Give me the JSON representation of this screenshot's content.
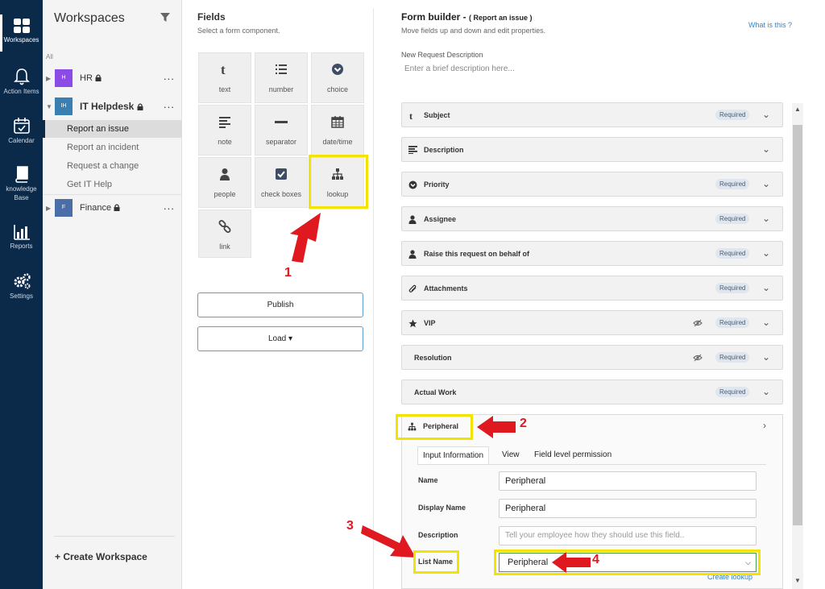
{
  "nav": {
    "items": [
      {
        "label": "Workspaces",
        "icon": "grid-icon"
      },
      {
        "label": "Action Items",
        "icon": "bell-icon"
      },
      {
        "label": "Calendar",
        "icon": "calendar-icon"
      },
      {
        "label_line1": "knowledge",
        "label_line2": "Base",
        "icon": "book-icon"
      },
      {
        "label": "Reports",
        "icon": "bar-chart-icon"
      },
      {
        "label": "Settings",
        "icon": "gears-icon"
      }
    ]
  },
  "workspaces": {
    "title": "Workspaces",
    "all_label": "All",
    "groups": [
      {
        "initial": "H",
        "name": "HR",
        "color": "#8a4be6"
      },
      {
        "initial": "IH",
        "name": "IT Helpdesk",
        "color": "#3a7fb2"
      },
      {
        "initial": "F",
        "name": "Finance",
        "color": "#4a6fa8"
      }
    ],
    "it_items": [
      "Report an issue",
      "Report an incident",
      "Request a change",
      "Get IT Help"
    ],
    "more": "...",
    "create": "+ Create Workspace"
  },
  "fields": {
    "title": "Fields",
    "subtitle": "Select a form component.",
    "tiles": [
      "text",
      "number",
      "choice",
      "note",
      "separator",
      "date/time",
      "people",
      "check boxes",
      "lookup",
      "link"
    ],
    "publish": "Publish",
    "load": "Load ▾"
  },
  "builder": {
    "title": "Form builder - ",
    "title_paren": "( Report an issue )",
    "subtitle": "Move fields up and down and edit properties.",
    "help": "What is this ?",
    "desc_label": "New Request Description",
    "desc_placeholder": "Enter a brief description here...",
    "required": "Required",
    "rows": [
      {
        "label": "Subject",
        "icon": "text-t-icon",
        "required": true
      },
      {
        "label": "Description",
        "icon": "align-left-icon",
        "required": false
      },
      {
        "label": "Priority",
        "icon": "chevron-circle-icon",
        "required": true
      },
      {
        "label": "Assignee",
        "icon": "person-icon",
        "required": true
      },
      {
        "label": "Raise this request on behalf of",
        "icon": "person-icon",
        "required": true
      },
      {
        "label": "Attachments",
        "icon": "paperclip-icon",
        "required": true
      },
      {
        "label": "VIP",
        "icon": "star-icon",
        "required": true,
        "hidden": true
      },
      {
        "label": "Resolution",
        "icon": "",
        "required": true,
        "hidden": true
      },
      {
        "label": "Actual Work",
        "icon": "",
        "required": true
      }
    ],
    "peripheral": {
      "label": "Peripheral",
      "tabs": [
        "Input Information",
        "View",
        "Field level permission"
      ],
      "name_label": "Name",
      "name_value": "Peripheral",
      "display_label": "Display Name",
      "display_value": "Peripheral",
      "description_label": "Description",
      "description_placeholder": "Tell your employee how they should use this field..",
      "list_label": "List Name",
      "list_value": "Peripheral",
      "create_lookup": "Create lookup"
    }
  },
  "annotations": [
    "1",
    "2",
    "3",
    "4"
  ],
  "colors": {
    "nav_bg": "#0b2a4a",
    "highlight": "#f2e400",
    "arrow": "#e0181f",
    "accent": "#3a83c4"
  }
}
